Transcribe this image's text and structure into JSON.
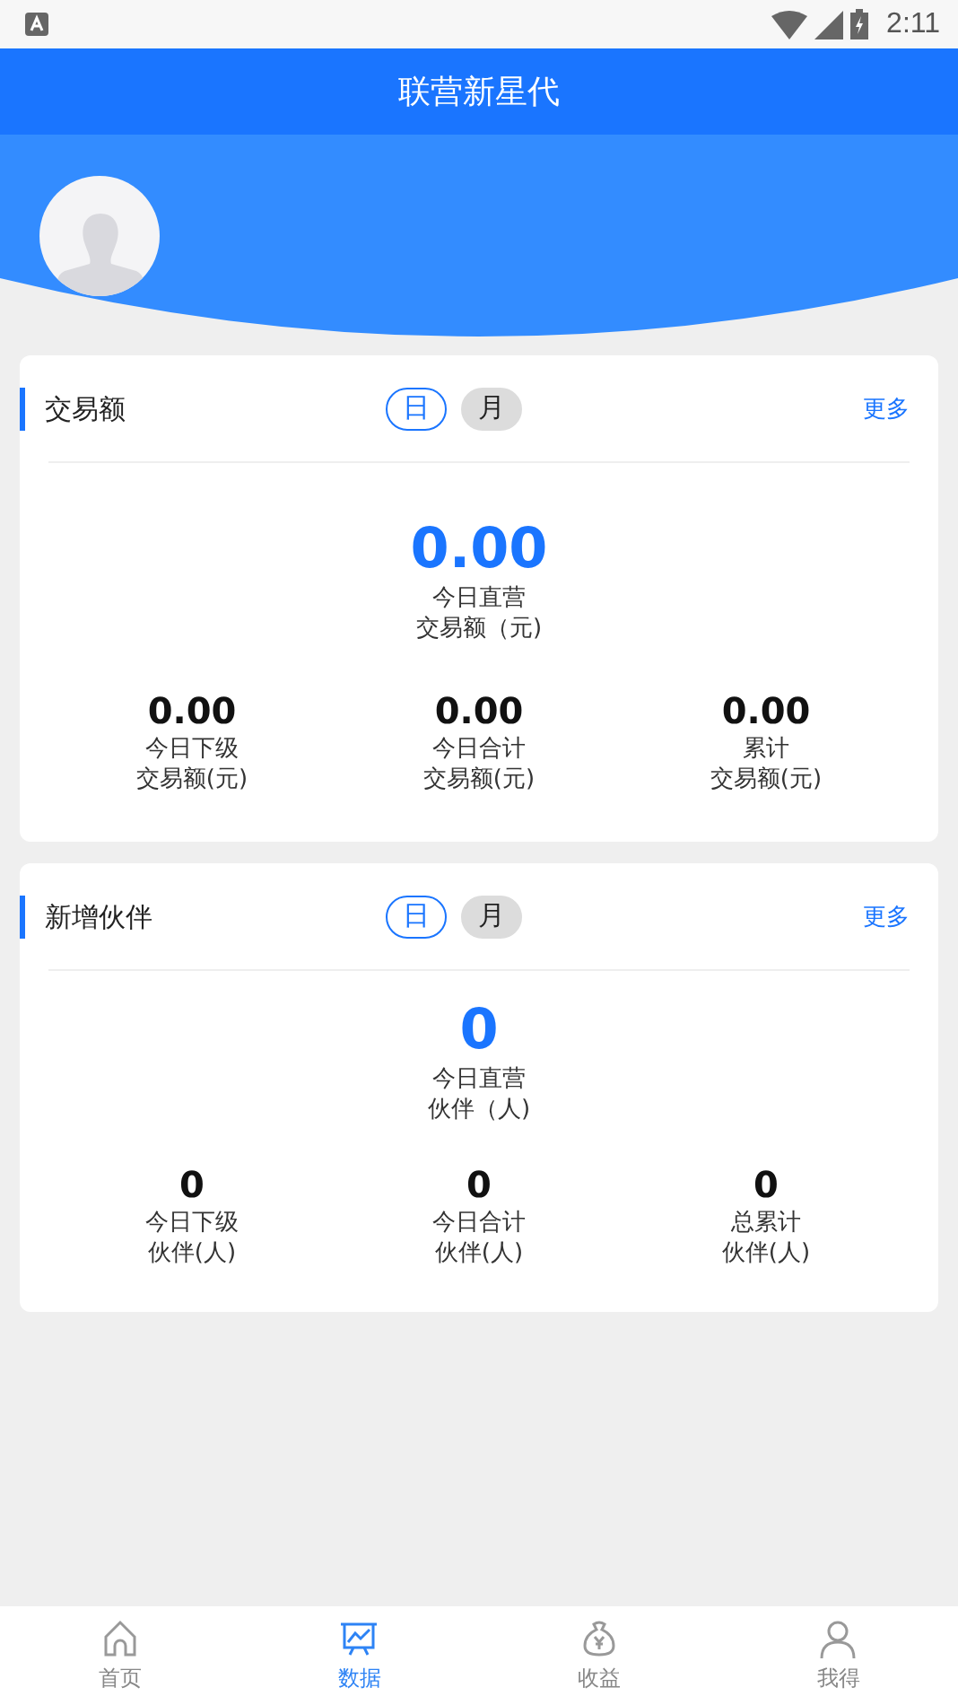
{
  "status_bar": {
    "time": "2:11"
  },
  "header": {
    "title": "联营新星代"
  },
  "cards": [
    {
      "title": "交易额",
      "tabs": [
        {
          "label": "日",
          "selected": true
        },
        {
          "label": "月",
          "selected": false
        }
      ],
      "more": "更多",
      "main": {
        "value": "0.00",
        "label_1": "今日直营",
        "label_2": "交易额（元)"
      },
      "stats": [
        {
          "value": "0.00",
          "label_1": "今日下级",
          "label_2": "交易额(元)"
        },
        {
          "value": "0.00",
          "label_1": "今日合计",
          "label_2": "交易额(元)"
        },
        {
          "value": "0.00",
          "label_1": "累计",
          "label_2": "交易额(元)"
        }
      ]
    },
    {
      "title": "新增伙伴",
      "tabs": [
        {
          "label": "日",
          "selected": true
        },
        {
          "label": "月",
          "selected": false
        }
      ],
      "more": "更多",
      "main": {
        "value": "0",
        "label_1": "今日直营",
        "label_2": "伙伴（人)"
      },
      "stats": [
        {
          "value": "0",
          "label_1": "今日下级",
          "label_2": "伙伴(人)"
        },
        {
          "value": "0",
          "label_1": "今日合计",
          "label_2": "伙伴(人)"
        },
        {
          "value": "0",
          "label_1": "总累计",
          "label_2": "伙伴(人)"
        }
      ]
    }
  ],
  "bottom_nav": [
    {
      "kind": "home",
      "label": "首页",
      "selected": false
    },
    {
      "kind": "chart",
      "label": "数据",
      "selected": true
    },
    {
      "kind": "money",
      "label": "收益",
      "selected": false
    },
    {
      "kind": "person",
      "label": "我得",
      "selected": false
    }
  ]
}
